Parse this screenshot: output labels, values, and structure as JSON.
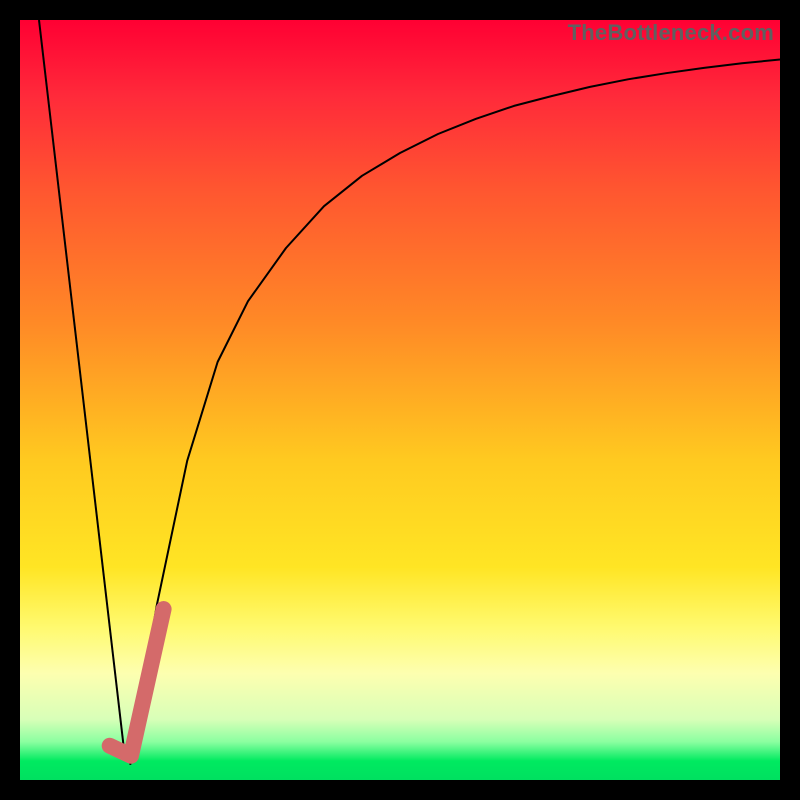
{
  "attribution": "TheBottleneck.com",
  "chart_data": {
    "type": "line",
    "title": "",
    "xlabel": "",
    "ylabel": "",
    "xlim": [
      0,
      100
    ],
    "ylim": [
      0,
      100
    ],
    "grid": false,
    "legend": false,
    "background": "red-to-green vertical gradient",
    "series": [
      {
        "name": "left-descent",
        "color": "#000000",
        "stroke_width": 2,
        "x": [
          2.5,
          13.8
        ],
        "values": [
          100,
          3
        ]
      },
      {
        "name": "rising-curve",
        "color": "#000000",
        "stroke_width": 2,
        "x": [
          14.5,
          18,
          22,
          26,
          30,
          35,
          40,
          45,
          50,
          55,
          60,
          65,
          70,
          75,
          80,
          85,
          90,
          95,
          100
        ],
        "values": [
          2,
          23,
          42,
          55,
          63,
          70,
          75.5,
          79.5,
          82.5,
          85,
          87,
          88.7,
          90,
          91.2,
          92.2,
          93,
          93.7,
          94.3,
          94.8
        ]
      },
      {
        "name": "notch-marker",
        "color": "#d46a6a",
        "stroke_width": 16,
        "stroke_linecap": "round",
        "x": [
          11.8,
          14.6,
          18.9
        ],
        "values": [
          4.5,
          3.2,
          22.5
        ]
      }
    ]
  }
}
